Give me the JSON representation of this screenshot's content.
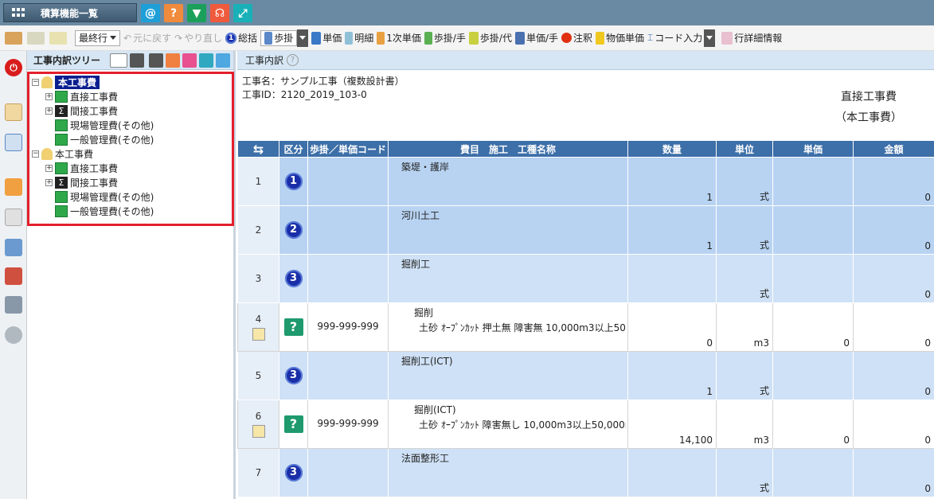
{
  "app": {
    "tab_label": "積算機能一覧"
  },
  "top_icons": [
    {
      "name": "at-icon",
      "glyph": "@",
      "color": "#1e9fd8"
    },
    {
      "name": "help-icon",
      "glyph": "?",
      "color": "#f08a3c"
    },
    {
      "name": "beginner-icon",
      "glyph": "▼",
      "color": "#1aa05a"
    },
    {
      "name": "support-icon",
      "glyph": "☊",
      "color": "#f05a3c"
    },
    {
      "name": "resize-icon",
      "glyph": "⤢",
      "color": "#1ab0b8"
    }
  ],
  "toolbar": {
    "latest_row": "最終行",
    "undo": "元に戻す",
    "redo": "やり直し",
    "summary": "総括",
    "ayugake": "歩掛",
    "unit_price": "単価",
    "detail": "明細",
    "primary_unit_price": "1次単価",
    "ayugake_hand": "歩掛/手",
    "ayugake_proxy": "歩掛/代",
    "unit_price_hand": "単価/手",
    "note": "注釈",
    "goods_unit_price": "物価単価",
    "code_input": "コード入力",
    "row_detail_info": "行詳細情報"
  },
  "tree": {
    "title": "工事内訳ツリー",
    "nodes": [
      {
        "label": "本工事費",
        "level": 0,
        "type": "root",
        "selected": true
      },
      {
        "label": "直接工事費",
        "level": 1,
        "type": "list",
        "expandable": true
      },
      {
        "label": "間接工事費",
        "level": 1,
        "type": "sigma",
        "expandable": true
      },
      {
        "label": "現場管理費(その他)",
        "level": 1,
        "type": "list",
        "expandable": false
      },
      {
        "label": "一般管理費(その他)",
        "level": 1,
        "type": "list",
        "expandable": false
      },
      {
        "label": "本工事費",
        "level": 0,
        "type": "root",
        "selected": false
      },
      {
        "label": "直接工事費",
        "level": 1,
        "type": "list",
        "expandable": true
      },
      {
        "label": "間接工事費",
        "level": 1,
        "type": "sigma",
        "expandable": true
      },
      {
        "label": "現場管理費(その他)",
        "level": 1,
        "type": "list",
        "expandable": false
      },
      {
        "label": "一般管理費(その他)",
        "level": 1,
        "type": "list",
        "expandable": false
      }
    ]
  },
  "main": {
    "title": "工事内訳",
    "project_name": "工事名：サンプル工事（複数設計書）",
    "project_id": "工事ID：2120_2019_103-0",
    "section_title": "直接工事費",
    "section_sub": "（本工事費）",
    "columns": [
      "⇆",
      "区分",
      "歩掛／単価コード",
      "費目　施工　工種名称",
      "数量",
      "単位",
      "単価",
      "金額"
    ],
    "rows": [
      {
        "no": "1",
        "kind": "circle",
        "level": "1",
        "code": "",
        "name1": "築堤・護岸",
        "name2": "",
        "qty": "1",
        "unit": "式",
        "price": "",
        "amount": "0",
        "style": "blue"
      },
      {
        "no": "2",
        "kind": "circle",
        "level": "2",
        "code": "",
        "name1": "河川土工",
        "name2": "",
        "qty": "1",
        "unit": "式",
        "price": "",
        "amount": "0",
        "style": "blue"
      },
      {
        "no": "3",
        "kind": "circle",
        "level": "3",
        "code": "",
        "name1": "掘削工",
        "name2": "",
        "qty": "",
        "unit": "式",
        "price": "",
        "amount": "0",
        "style": "lblue"
      },
      {
        "no": "4",
        "kind": "question",
        "level": "?",
        "code": "999-999-999",
        "name1": "掘削",
        "name2": "土砂 ｵｰﾌﾟﾝｶｯﾄ 押土無 障害無 10,000m3以上50",
        "qty": "0",
        "unit": "m3",
        "price": "0",
        "amount": "0",
        "style": "white"
      },
      {
        "no": "5",
        "kind": "circle",
        "level": "3",
        "code": "",
        "name1": "掘削工(ICT)",
        "name2": "",
        "qty": "1",
        "unit": "式",
        "price": "",
        "amount": "0",
        "style": "lblue"
      },
      {
        "no": "6",
        "kind": "question",
        "level": "?",
        "code": "999-999-999",
        "name1": "掘削(ICT)",
        "name2": "土砂 ｵｰﾌﾟﾝｶｯﾄ 障害無し 10,000m3以上50,000r",
        "qty": "14,100",
        "unit": "m3",
        "price": "0",
        "amount": "0",
        "style": "white"
      },
      {
        "no": "7",
        "kind": "circle",
        "level": "3",
        "code": "",
        "name1": "法面整形工",
        "name2": "",
        "qty": "",
        "unit": "式",
        "price": "",
        "amount": "0",
        "style": "lblue"
      }
    ]
  }
}
